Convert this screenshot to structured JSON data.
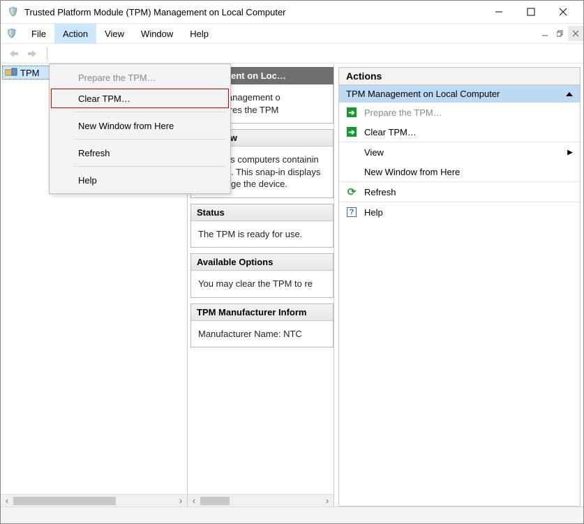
{
  "title": "Trusted Platform Module (TPM) Management on Local Computer",
  "menus": {
    "file": "File",
    "action": "Action",
    "view": "View",
    "window": "Window",
    "help": "Help"
  },
  "action_menu": {
    "prepare": "Prepare the TPM…",
    "clear": "Clear TPM…",
    "new_window": "New Window from Here",
    "refresh": "Refresh",
    "help": "Help"
  },
  "tree": {
    "root": "TPM"
  },
  "center": {
    "header": "anagement on Loc…",
    "intro": "TPM Management o\nConfigures the TPM",
    "overview_head": "Overview",
    "overview_body": "Windows computers containin\nfeatures. This snap-in displays\nto manage the device.",
    "status_head": "Status",
    "status_body": "The TPM is ready for use.",
    "options_head": "Available Options",
    "options_body": "You may clear the TPM to re",
    "mfr_head": "TPM Manufacturer Inform",
    "mfr_body": "Manufacturer Name:  NTC"
  },
  "actions": {
    "header": "Actions",
    "group": "TPM Management on Local Computer",
    "prepare": "Prepare the TPM…",
    "clear": "Clear TPM…",
    "view": "View",
    "new_window": "New Window from Here",
    "refresh": "Refresh",
    "help": "Help"
  }
}
